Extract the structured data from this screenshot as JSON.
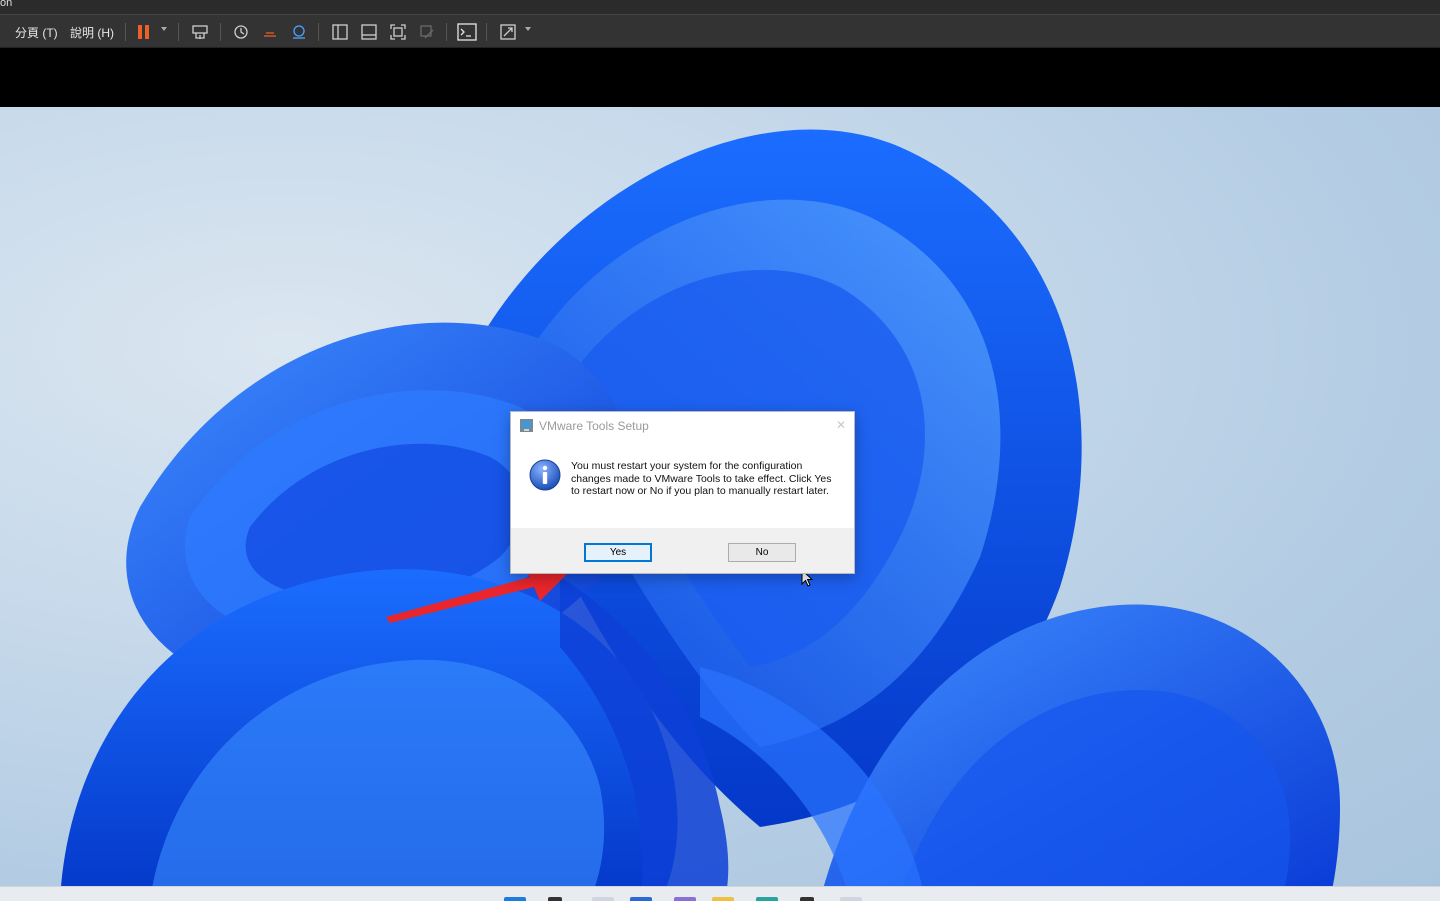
{
  "window": {
    "title_fragment": "on"
  },
  "menubar": {
    "items": [
      {
        "label": "分頁 (T)"
      },
      {
        "label": "說明 (H)"
      }
    ]
  },
  "toolbar": {
    "icons": [
      "pause-icon",
      "send-ctrl-alt-del-icon",
      "snapshot-icon",
      "revert-snapshot-icon",
      "snapshot-manager-icon",
      "show-library-icon",
      "show-thumbnail-bar-icon",
      "full-screen-icon",
      "unity-icon",
      "console-view-icon",
      "stretch-guest-icon"
    ],
    "accent": "#e8622a"
  },
  "dialog": {
    "title": "VMware Tools Setup",
    "message": "You must restart your system for the configuration changes made to VMware Tools to take effect. Click Yes to restart now or No if you plan to manually restart later.",
    "yes_label": "Yes",
    "no_label": "No",
    "close_glyph": "✕"
  },
  "annotation": {
    "arrow_color": "#e8262b"
  }
}
